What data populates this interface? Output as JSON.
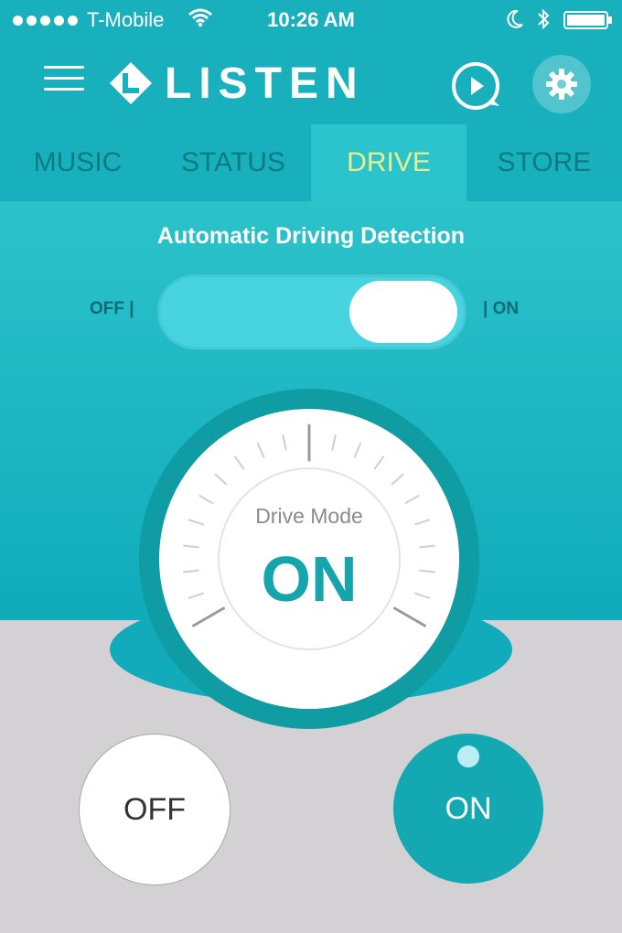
{
  "status_bar": {
    "carrier": "T-Mobile",
    "time": "10:26 AM",
    "signal_icon": "signal-dots-icon",
    "wifi_icon": "wifi-icon",
    "moon_icon": "moon-icon",
    "bluetooth_icon": "bluetooth-icon",
    "battery_icon": "battery-icon"
  },
  "header": {
    "brand": "LISTEN",
    "menu_icon": "hamburger-menu-icon",
    "play_icon": "play-chat-icon",
    "settings_icon": "gear-icon"
  },
  "tabs": [
    {
      "label": "MUSIC",
      "active": false
    },
    {
      "label": "STATUS",
      "active": false
    },
    {
      "label": "DRIVE",
      "active": true
    },
    {
      "label": "STORE",
      "active": false
    }
  ],
  "detection": {
    "title": "Automatic Driving Detection",
    "off_label": "OFF |",
    "on_label": "| ON",
    "toggle_on": true
  },
  "dial": {
    "label": "Drive Mode",
    "value": "ON"
  },
  "buttons": {
    "off": "OFF",
    "on": "ON"
  },
  "colors": {
    "teal": "#19b0bd",
    "active_tab_text": "#e7ee8c",
    "bottom_gray": "#d3d1d4"
  }
}
